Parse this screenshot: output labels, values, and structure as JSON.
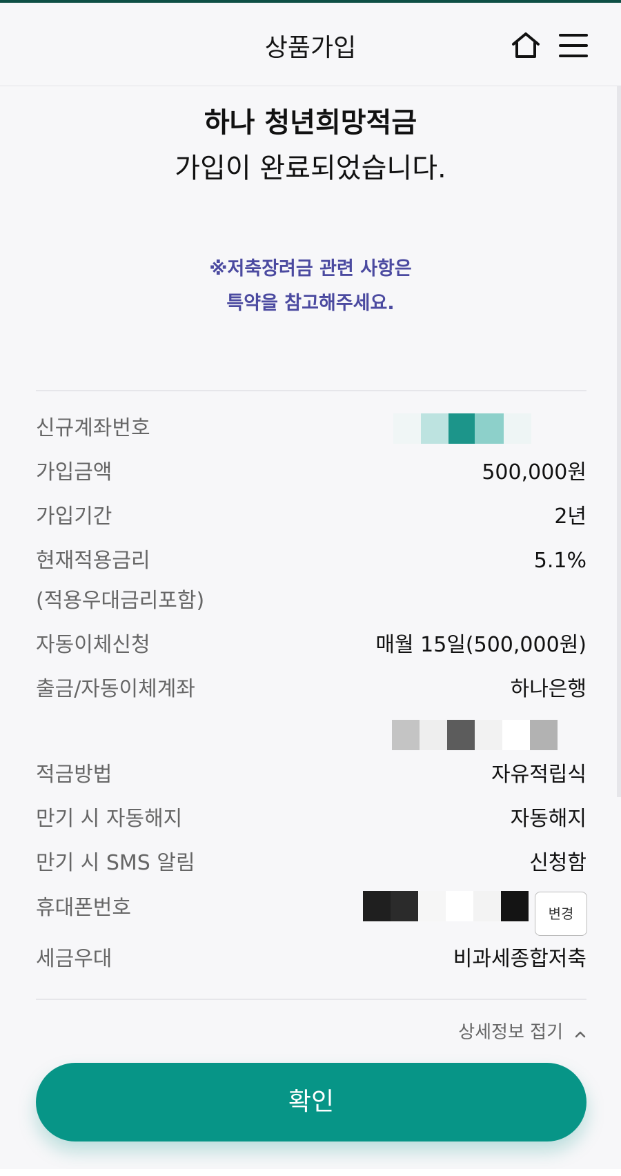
{
  "header": {
    "title": "상품가입",
    "icons": {
      "home": "home-icon",
      "menu": "menu-icon"
    }
  },
  "completion": {
    "product_name": "하나 청년희망적금",
    "message": "가입이 완료되었습니다."
  },
  "notice": {
    "line1": "※저축장려금 관련 사항은",
    "line2": "특약을 참고해주세요."
  },
  "details": {
    "new_account_label": "신규계좌번호",
    "amount_label": "가입금액",
    "amount_value": "500,000원",
    "period_label": "가입기간",
    "period_value": "2년",
    "rate_label_line1": "현재적용금리",
    "rate_label_line2": "(적용우대금리포함)",
    "rate_value": "5.1%",
    "auto_transfer_label": "자동이체신청",
    "auto_transfer_value": "매월 15일(500,000원)",
    "withdraw_account_label": "출금/자동이체계좌",
    "withdraw_bank": "하나은행",
    "method_label": "적금방법",
    "method_value": "자유적립식",
    "auto_termination_label": "만기 시 자동해지",
    "auto_termination_value": "자동해지",
    "sms_label": "만기 시 SMS 알림",
    "sms_value": "신청함",
    "phone_label": "휴대폰번호",
    "change_button": "변경",
    "tax_label": "세금우대",
    "tax_value": "비과세종합저축"
  },
  "fold_link": "상세정보 접기",
  "confirm_button": "확인",
  "colors": {
    "accent": "#079587",
    "notice": "#4b4aa0",
    "top_bar": "#0e4f45"
  }
}
